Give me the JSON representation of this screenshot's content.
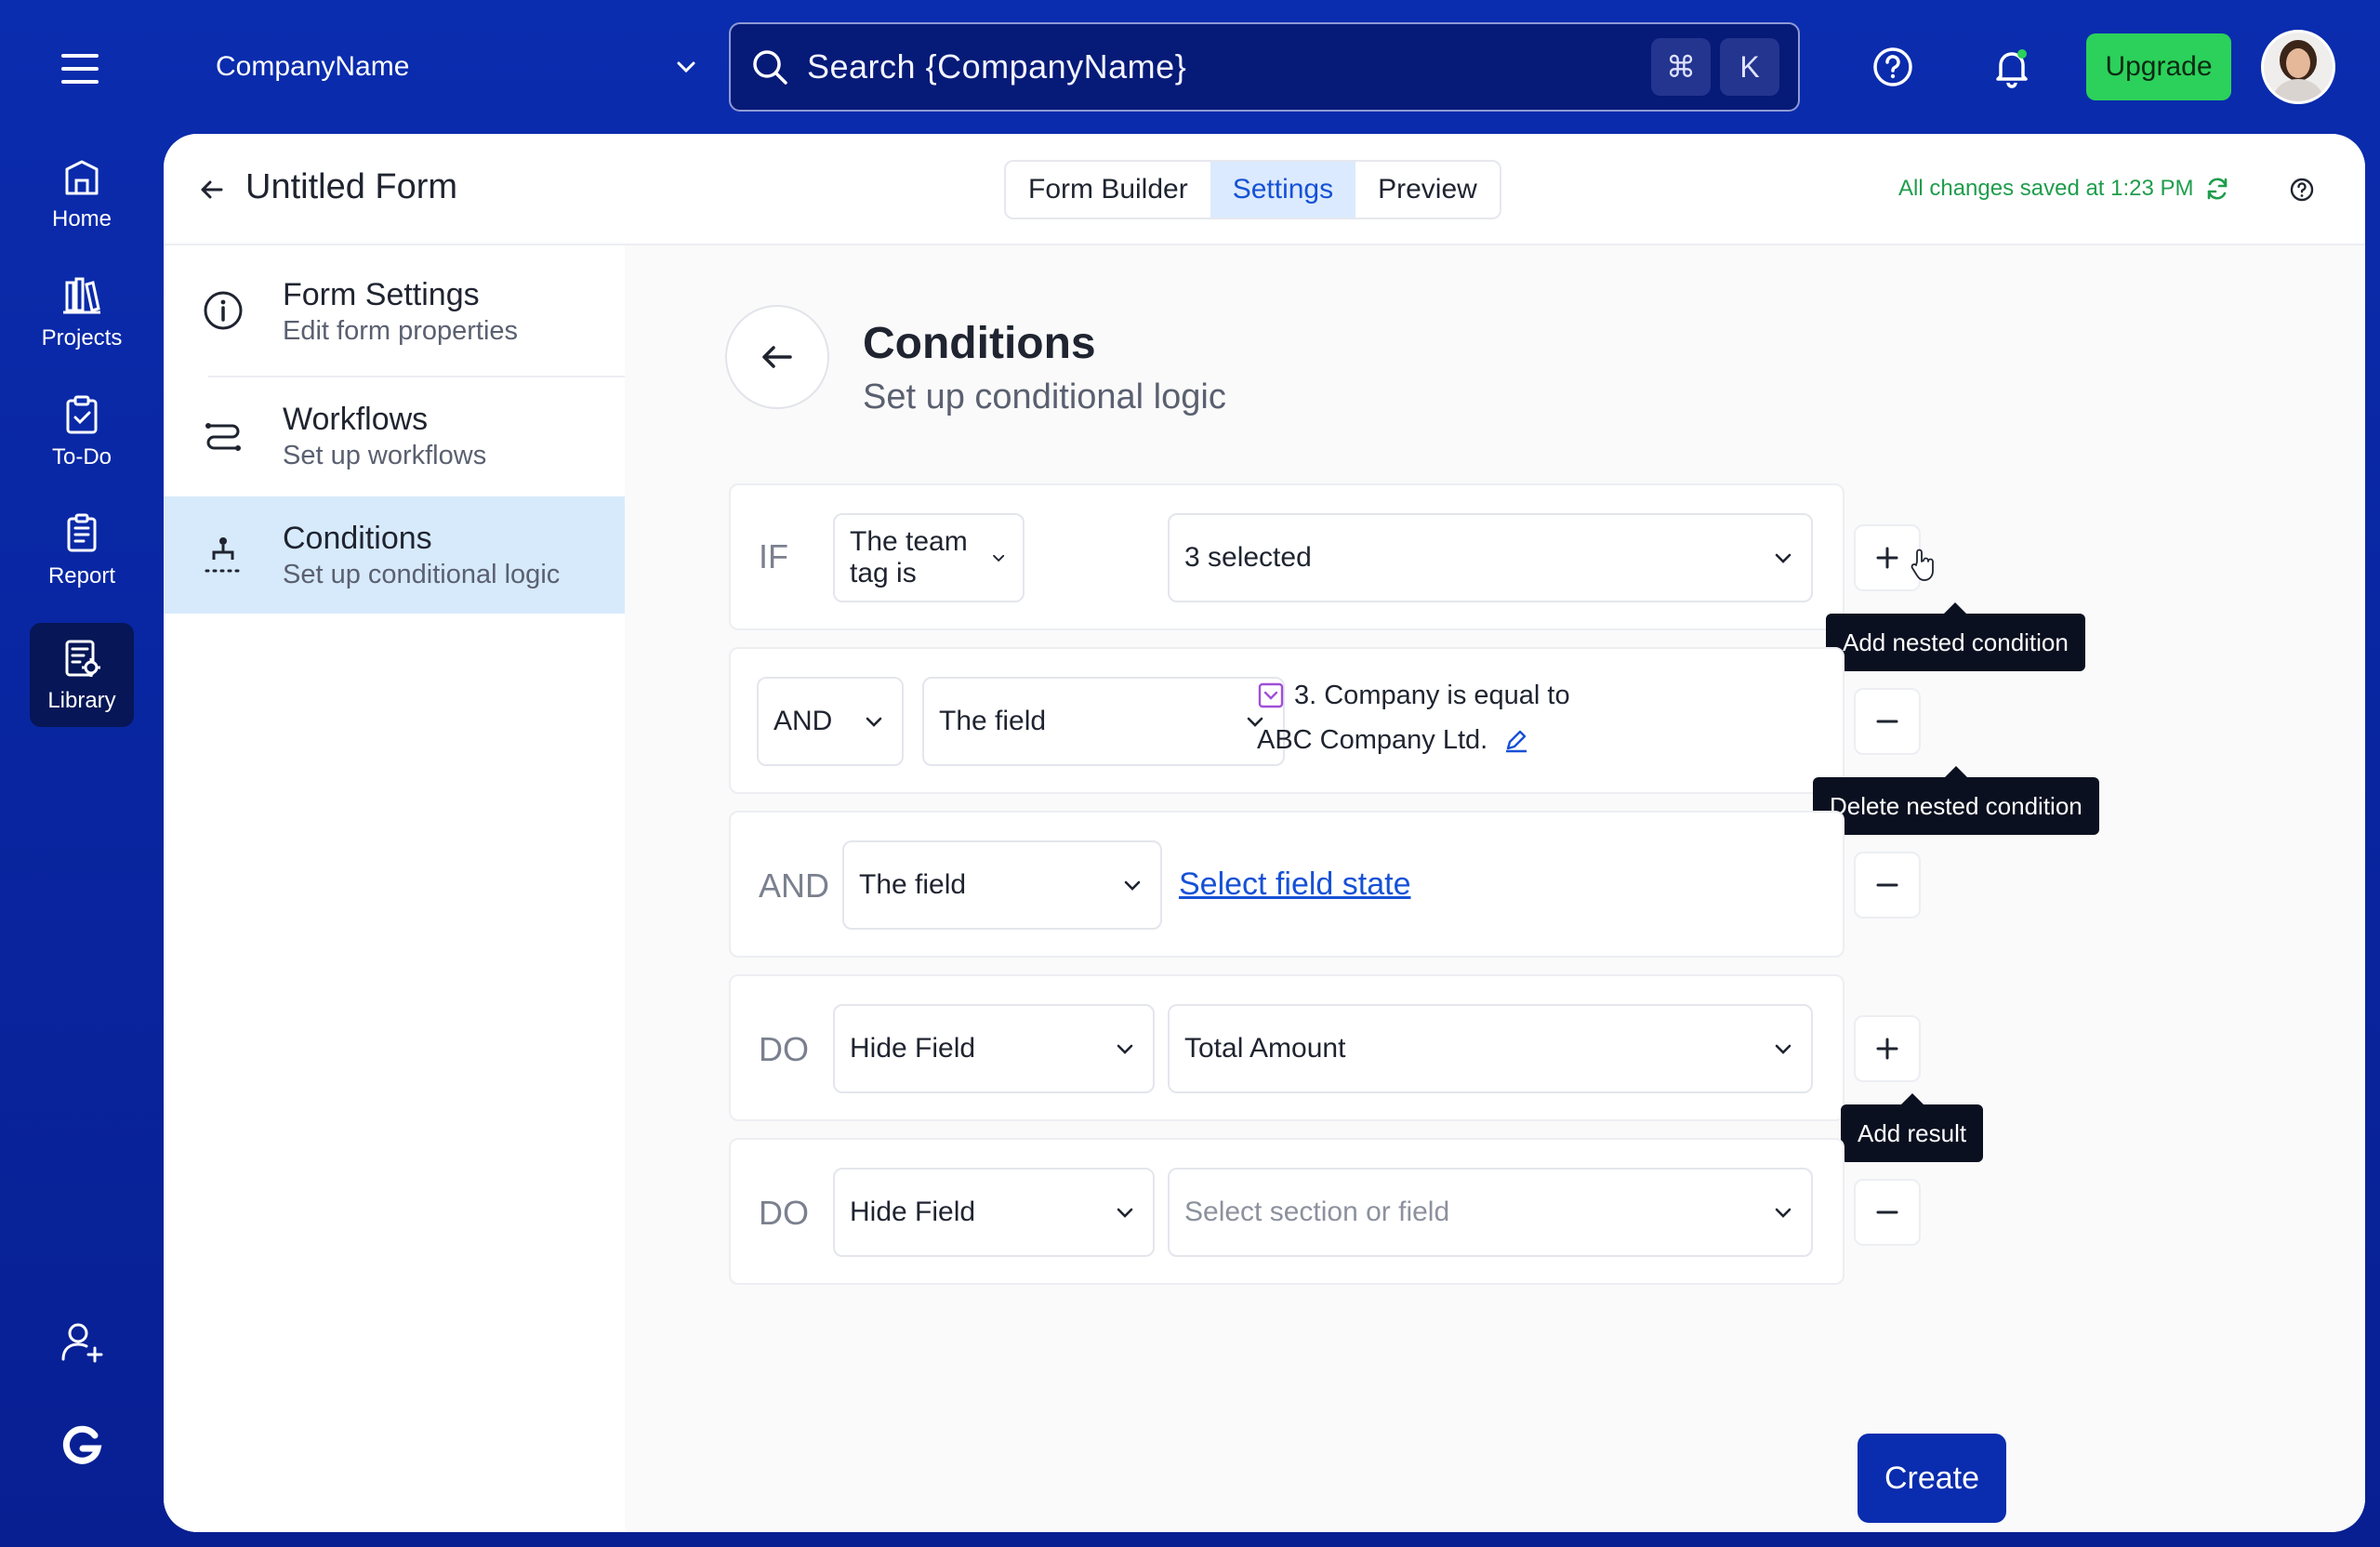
{
  "topbar": {
    "company": "CompanyName",
    "search_placeholder": "Search {CompanyName}",
    "kbd_cmd": "⌘",
    "kbd_k": "K",
    "upgrade_label": "Upgrade"
  },
  "nav": {
    "home": "Home",
    "projects": "Projects",
    "todo": "To-Do",
    "report": "Report",
    "library": "Library"
  },
  "header": {
    "title": "Untitled Form",
    "tabs": [
      "Form Builder",
      "Settings",
      "Preview"
    ],
    "active_tab": "Settings",
    "saved_status": "All changes saved at 1:23 PM"
  },
  "side_menu": [
    {
      "title": "Form Settings",
      "subtitle": "Edit form properties"
    },
    {
      "title": "Workflows",
      "subtitle": "Set up workflows"
    },
    {
      "title": "Conditions",
      "subtitle": "Set up conditional logic"
    }
  ],
  "conditions": {
    "title": "Conditions",
    "subtitle": "Set up conditional logic",
    "rows": [
      {
        "keyword": "IF",
        "select1": "The team tag is",
        "select2": "3 selected"
      },
      {
        "keyword": "AND",
        "select1": "The field",
        "value_line1": "3. Company is equal to",
        "value_line2": "ABC Company Ltd."
      },
      {
        "keyword": "AND",
        "select1": "The field",
        "link": "Select field state"
      },
      {
        "keyword": "DO",
        "select1": "Hide Field",
        "select2": "Total Amount"
      },
      {
        "keyword": "DO",
        "select1": "Hide Field",
        "select2_placeholder": "Select section or field"
      }
    ],
    "tooltips": {
      "add_nested": "Add nested condition",
      "delete_nested": "Delete nested condition",
      "add_result": "Add result"
    },
    "create_label": "Create"
  }
}
